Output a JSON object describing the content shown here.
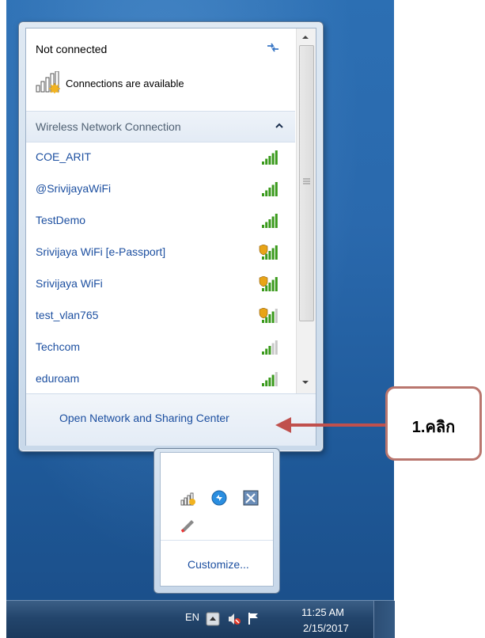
{
  "flyout": {
    "status_title": "Not connected",
    "available_text": "Connections are available",
    "section_title": "Wireless Network Connection",
    "networks": [
      {
        "name": "COE_ARIT",
        "secured": false,
        "signal": "strong"
      },
      {
        "name": "@SrivijayaWiFi",
        "secured": false,
        "signal": "strong"
      },
      {
        "name": "TestDemo",
        "secured": false,
        "signal": "strong"
      },
      {
        "name": "Srivijaya WiFi [e-Passport]",
        "secured": true,
        "signal": "strong"
      },
      {
        "name": "Srivijaya WiFi",
        "secured": true,
        "signal": "strong"
      },
      {
        "name": "test_vlan765",
        "secured": true,
        "signal": "medium"
      },
      {
        "name": "Techcom",
        "secured": false,
        "signal": "weak"
      },
      {
        "name": "eduroam",
        "secured": false,
        "signal": "medium"
      }
    ],
    "footer_link": "Open Network and Sharing Center"
  },
  "tray_popup": {
    "customize_label": "Customize..."
  },
  "taskbar": {
    "language": "EN",
    "time": "11:25 AM",
    "date": "2/15/2017"
  },
  "callout": {
    "text": "1.คลิก"
  },
  "colors": {
    "link": "#1c4fa0",
    "signal_green": "#3a9a1c",
    "callout_border": "#b9766e",
    "arrow": "#c0504d"
  }
}
